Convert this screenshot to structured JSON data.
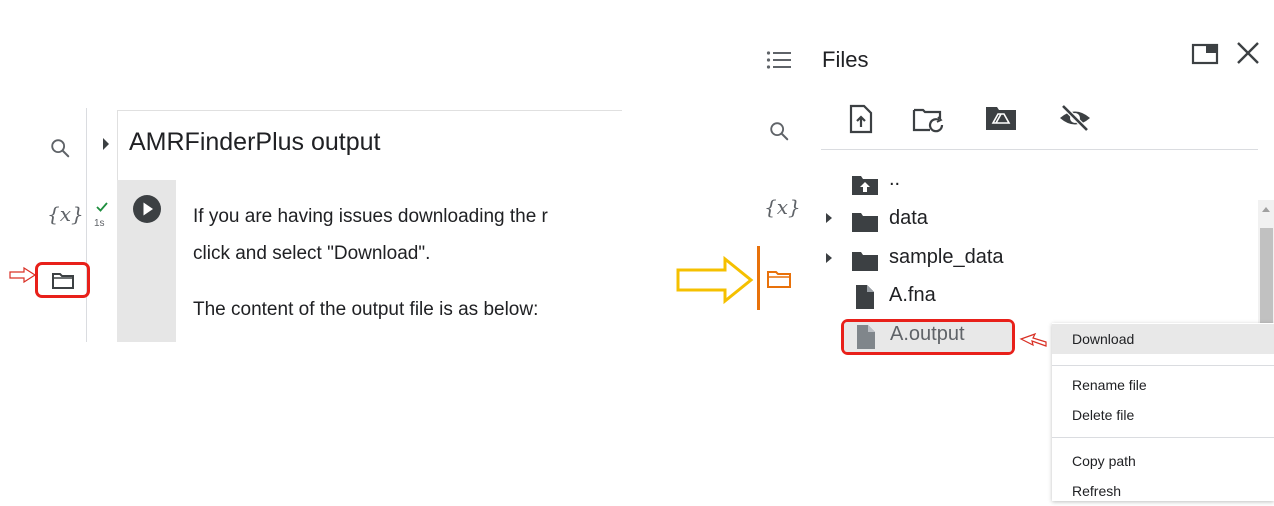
{
  "notebook": {
    "sidebar": {
      "search_icon": "search-icon",
      "variables_label": "{x}",
      "files_icon": "folder-icon"
    },
    "cell_status": {
      "check_icon": "check-icon",
      "time": "1s"
    },
    "section_heading": "AMRFinderPlus output",
    "text_cell": {
      "line1": "If you are having issues downloading the r",
      "line2": "click and select \"Download\".",
      "line3": "The content of the output file is as below:"
    },
    "highlight_color": "#e8201a"
  },
  "files_panel": {
    "sidebar": {
      "toc_icon": "list-icon",
      "search_icon": "search-icon",
      "variables_label": "{x}",
      "files_icon": "folder-icon"
    },
    "title": "Files",
    "toolbar": [
      "upload-file-icon",
      "refresh-folder-icon",
      "mount-drive-icon",
      "hide-files-icon"
    ],
    "tree": [
      {
        "name": "..",
        "type": "parent-folder"
      },
      {
        "name": "data",
        "type": "folder",
        "expandable": true
      },
      {
        "name": "sample_data",
        "type": "folder",
        "expandable": true
      },
      {
        "name": "A.fna",
        "type": "file"
      },
      {
        "name": "A.output",
        "type": "file",
        "selected": true
      }
    ],
    "context_menu": {
      "items": [
        "Download",
        "Rename file",
        "Delete file",
        "Copy path",
        "Refresh"
      ],
      "hovered": "Download"
    },
    "accent_color": "#e8710a",
    "arrow_color": "#f5c000"
  }
}
